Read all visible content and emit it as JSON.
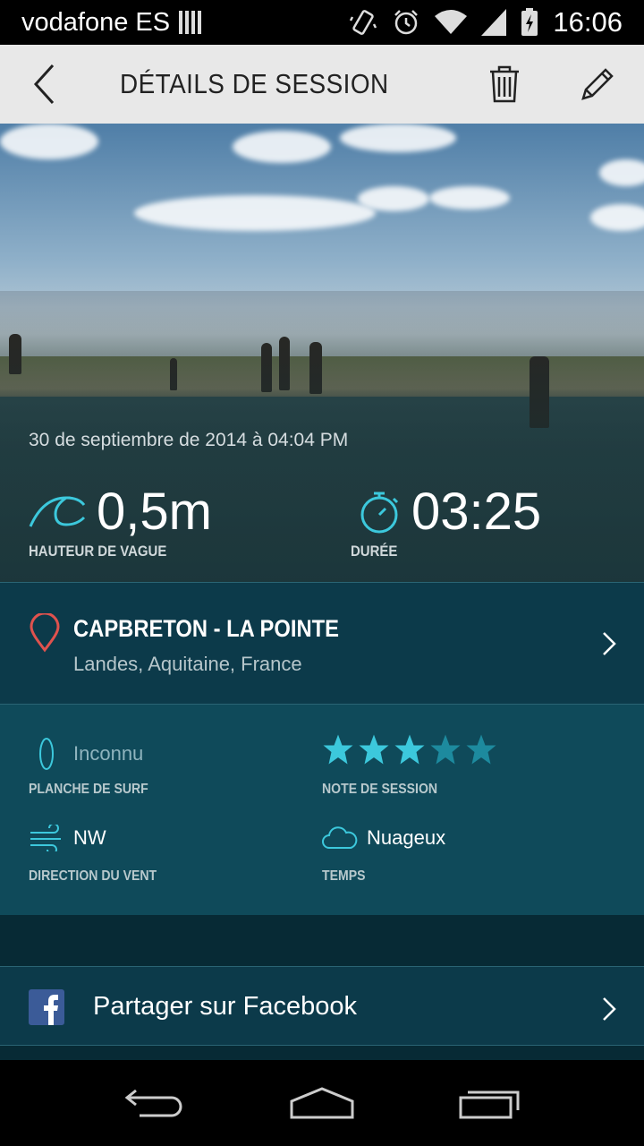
{
  "status_bar": {
    "carrier": "vodafone ES",
    "time": "16:06",
    "icons": [
      "sim-icon",
      "vibrate-icon",
      "alarm-icon",
      "wifi-icon",
      "signal-icon",
      "battery-charging-icon"
    ]
  },
  "header": {
    "title": "DÉTAILS DE SESSION",
    "back_icon": "chevron-left-icon",
    "delete_icon": "trash-icon",
    "edit_icon": "pencil-icon"
  },
  "session": {
    "date": "30 de septiembre de 2014 à 04:04 PM",
    "wave_height": "0,5m",
    "wave_height_label": "HAUTEUR DE VAGUE",
    "duration": "03:25",
    "duration_label": "DURÉE"
  },
  "location": {
    "name": "CAPBRETON - LA POINTE",
    "region": "Landes, Aquitaine, France"
  },
  "details": {
    "board_value": "Inconnu",
    "board_label": "PLANCHE DE SURF",
    "rating_label": "NOTE DE SESSION",
    "rating": 3,
    "rating_max": 5,
    "wind_value": "NW",
    "wind_label": "DIRECTION DU VENT",
    "weather_value": "Nuageux",
    "weather_label": "TEMPS"
  },
  "share": {
    "label": "Partager sur Facebook"
  },
  "colors": {
    "accent": "#3cc8dc",
    "panel": "#0f4a5a",
    "panel_dark": "#0c3a4a",
    "pin": "#e0524e"
  }
}
